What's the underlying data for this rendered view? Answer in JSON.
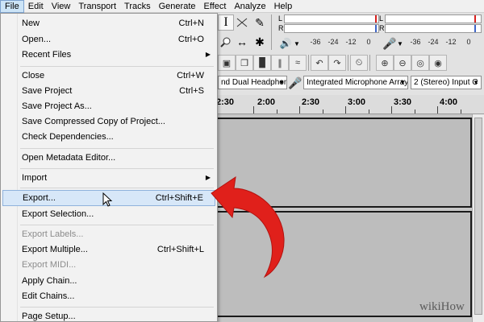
{
  "menubar": {
    "items": [
      "File",
      "Edit",
      "View",
      "Transport",
      "Tracks",
      "Generate",
      "Effect",
      "Analyze",
      "Help"
    ],
    "active": "File"
  },
  "meters": {
    "left_channel": "L",
    "right_channel": "R",
    "recording_ticks": [
      "-36",
      "-24",
      "-12",
      "0"
    ],
    "playback_ticks": [
      "-36",
      "-24",
      "-12",
      "0"
    ]
  },
  "devices": {
    "playback": "nd Dual Headphone",
    "recording": "Integrated Microphone Array",
    "channels": "2 (Stereo) Input C"
  },
  "timeline": {
    "labels": [
      "2:30",
      "2:00",
      "2:30",
      "3:00",
      "3:30",
      "4:00"
    ]
  },
  "file_menu": {
    "items": [
      {
        "label": "New",
        "shortcut": "Ctrl+N"
      },
      {
        "label": "Open...",
        "shortcut": "Ctrl+O"
      },
      {
        "label": "Recent Files",
        "submenu": true
      },
      {
        "label": "Close",
        "shortcut": "Ctrl+W"
      },
      {
        "label": "Save Project",
        "shortcut": "Ctrl+S"
      },
      {
        "label": "Save Project As..."
      },
      {
        "label": "Save Compressed Copy of Project..."
      },
      {
        "label": "Check Dependencies..."
      },
      {
        "label": "Open Metadata Editor..."
      },
      {
        "label": "Import",
        "submenu": true
      },
      {
        "label": "Export...",
        "shortcut": "Ctrl+Shift+E",
        "highlighted": true
      },
      {
        "label": "Export Selection..."
      },
      {
        "label": "Export Labels...",
        "disabled": true
      },
      {
        "label": "Export Multiple...",
        "shortcut": "Ctrl+Shift+L"
      },
      {
        "label": "Export MIDI...",
        "disabled": true
      },
      {
        "label": "Apply Chain..."
      },
      {
        "label": "Edit Chains..."
      },
      {
        "label": "Page Setup..."
      }
    ]
  },
  "icons": {
    "submenu_arrow": "chevron-right-icon",
    "cursor": "mouse-pointer-icon",
    "annotation": "curved-red-arrow-icon"
  },
  "colors": {
    "highlight": "#d7e7f8",
    "arrow": "#e0201b",
    "meter_mark_red": "#d9201e",
    "meter_mark_blue": "#3f66c8"
  },
  "watermark": "wikiHow"
}
